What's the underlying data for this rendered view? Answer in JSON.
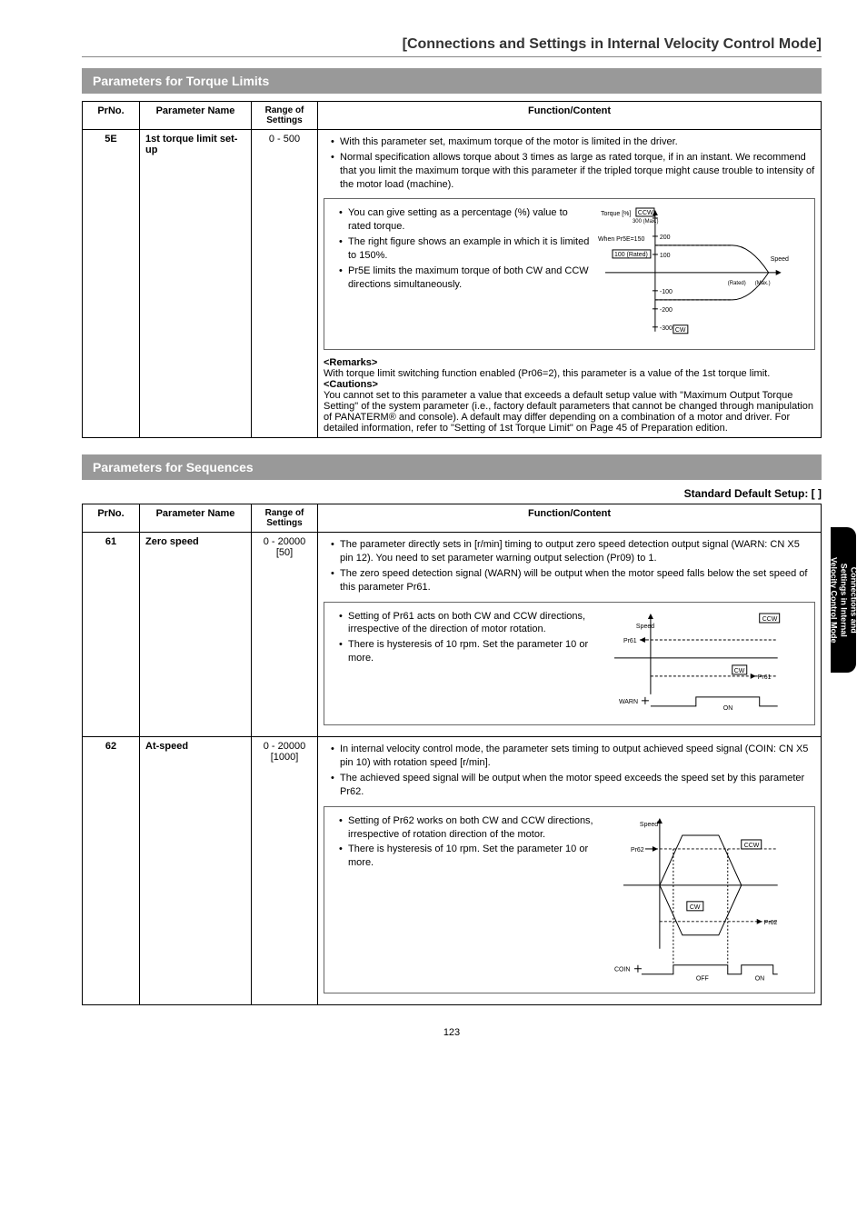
{
  "page": {
    "title": "[Connections and Settings in Internal Velocity Control Mode]",
    "number": "123"
  },
  "side_tab": {
    "line1": "Connections and",
    "line2": "Settings in Internal",
    "line3": "Velocity Control Mode"
  },
  "section_torque": {
    "header": "Parameters for Torque Limits",
    "columns": {
      "prno": "PrNo.",
      "pname": "Parameter Name",
      "range": "Range of Settings",
      "func": "Function/Content"
    },
    "row_5E": {
      "prno": "5E",
      "pname": "1st torque limit set-up",
      "range": "0 - 500",
      "bullets_top": [
        "With this parameter set, maximum torque of the motor is limited in the driver.",
        "Normal specification allows torque about 3 times as large as rated torque, if in an instant.  We recommend that you limit the maximum torque with this parameter if the tripled torque might cause trouble to intensity of the motor load (machine)."
      ],
      "inner": {
        "bullets": [
          "You can give setting as a percentage (%) value to rated torque.",
          "The right figure shows an example in which it is limited to 150%.",
          "Pr5E limits the maximum torque of both CW and CCW directions simultaneously."
        ]
      },
      "remarks_label": "<Remarks>",
      "remarks": "With torque limit switching function enabled (Pr06=2), this parameter is a value of the 1st torque limit.",
      "cautions_label": "<Cautions>",
      "cautions": "You cannot set to this parameter a value that exceeds a default setup value with \"Maximum Output Torque Setting\" of the system parameter (i.e., factory default parameters that cannot be changed through manipulation of PANATERM® and console).  A default may differ depending on a combination of a motor and driver.  For detailed information, refer to \"Setting of 1st Torque Limit\" on Page 45 of Preparation edition."
    }
  },
  "section_seq": {
    "header": "Parameters for Sequences",
    "default_setup": "Standard Default Setup: [    ]",
    "columns": {
      "prno": "PrNo.",
      "pname": "Parameter Name",
      "range": "Range of Settings",
      "func": "Function/Content"
    },
    "row_61": {
      "prno": "61",
      "pname": "Zero speed",
      "range": "0 - 20000 [50]",
      "bullets_top": [
        "The parameter directly sets in [r/min] timing to output zero speed detection output signal (WARN: CN X5 pin 12). You need to set parameter warning output selection (Pr09) to 1.",
        "The zero speed detection signal (WARN) will be output when the motor speed falls below the set speed of this parameter Pr61."
      ],
      "inner_bullets": [
        "Setting of Pr61 acts on both CW and CCW directions, irrespective of the direction of motor rotation.",
        "There is hysteresis of 10 rpm.  Set the parameter 10 or more."
      ]
    },
    "row_62": {
      "prno": "62",
      "pname": "At-speed",
      "range": "0 - 20000 [1000]",
      "bullets_top": [
        "In internal velocity control mode, the parameter sets timing to output achieved speed signal (COIN: CN X5 pin 10) with rotation speed [r/min].",
        "The achieved speed signal will be output when the motor speed exceeds the speed set by this parameter Pr62."
      ],
      "inner_bullets": [
        "Setting of Pr62 works on both CW and CCW directions, irrespective of rotation direction of the motor.",
        "There is hysteresis of 10 rpm.  Set the parameter 10 or more."
      ]
    }
  },
  "chart_data": [
    {
      "type": "line",
      "title": "Torque limit diagram",
      "xlabel": "Speed",
      "ylabel": "Torque [%]",
      "y_ticks_pos": [
        100,
        200,
        300
      ],
      "y_ticks_neg": [
        -100,
        -200,
        -300
      ],
      "annotations": {
        "ccw_box": "CCW",
        "cw_box": "CW",
        "max_label": "300 (Max.)",
        "pr5e_label": "When Pr5E=150",
        "rated_label": "100 (Rated)",
        "speed_axis": "Speed",
        "rated_right": "(Rated)",
        "max_right": "(Max.)"
      },
      "limit_value": 150
    },
    {
      "type": "line",
      "title": "Zero speed WARN timing",
      "labels": {
        "ccw": "CCW",
        "cw": "CW",
        "speed": "Speed",
        "pr61": "Pr61",
        "warn": "WARN",
        "on": "ON"
      }
    },
    {
      "type": "line",
      "title": "At-speed COIN timing",
      "labels": {
        "ccw": "CCW",
        "cw": "CW",
        "speed": "Speed",
        "pr62": "Pr62",
        "coin": "COIN",
        "off": "OFF",
        "on": "ON"
      }
    }
  ]
}
